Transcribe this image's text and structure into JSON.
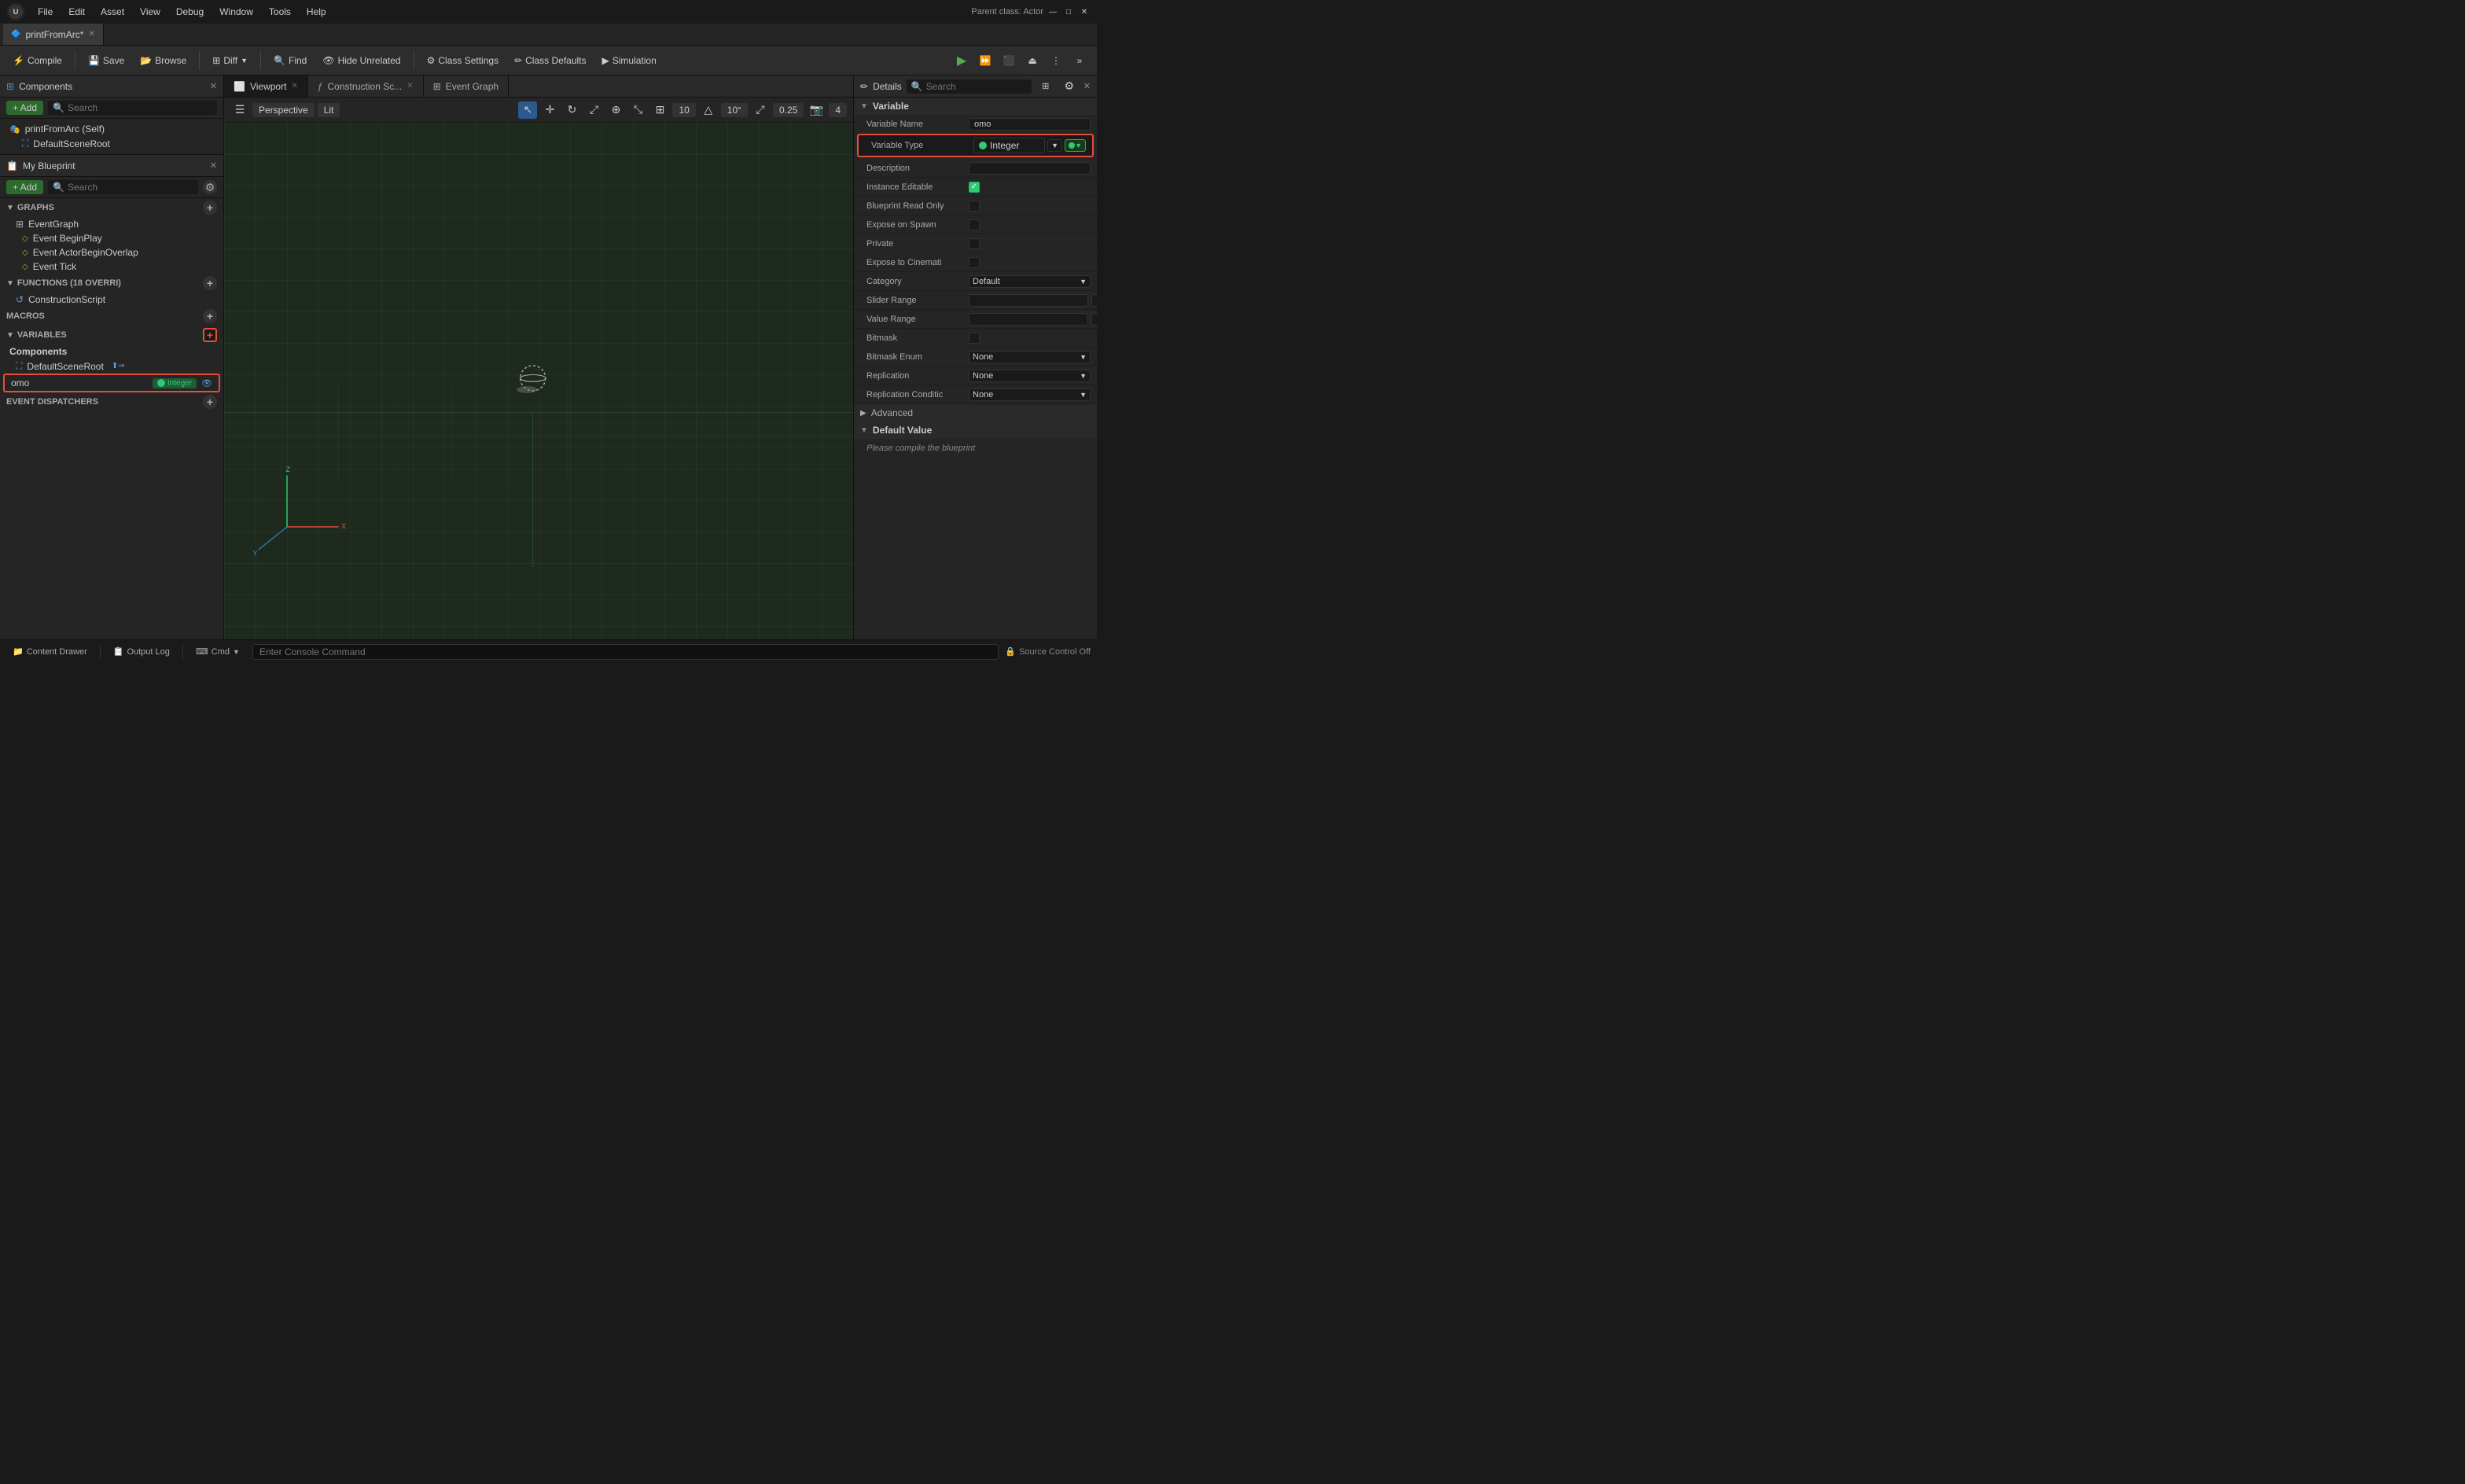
{
  "title": "printFromArc*",
  "parent_class": "Parent class: Actor",
  "menu": [
    "File",
    "Edit",
    "Asset",
    "View",
    "Debug",
    "Window",
    "Tools",
    "Help"
  ],
  "window_buttons": [
    "—",
    "□",
    "✕"
  ],
  "toolbar": {
    "compile": "Compile",
    "save": "Save",
    "browse": "Browse",
    "diff": "Diff",
    "find": "Find",
    "hide_unrelated": "Hide Unrelated",
    "class_settings": "Class Settings",
    "class_defaults": "Class Defaults",
    "simulation": "Simulation"
  },
  "components_panel": {
    "title": "Components",
    "add_label": "+ Add",
    "search_placeholder": "Search",
    "items": [
      {
        "label": "printFromArc (Self)",
        "type": "self"
      },
      {
        "label": "DefaultSceneRoot",
        "type": "root"
      }
    ]
  },
  "blueprint_panel": {
    "title": "My Blueprint",
    "add_label": "+ Add",
    "search_placeholder": "Search",
    "sections": {
      "graphs": "GRAPHS",
      "functions": "FUNCTIONS (18 OVERRI)",
      "macros": "MACROS",
      "variables": "VARIABLES",
      "event_dispatchers": "EVENT DISPATCHERS"
    },
    "graphs": [
      {
        "label": "EventGraph",
        "type": "graph"
      }
    ],
    "events": [
      {
        "label": "Event BeginPlay"
      },
      {
        "label": "Event ActorBeginOverlap"
      },
      {
        "label": "Event Tick"
      }
    ],
    "functions": [
      {
        "label": "ConstructionScript"
      }
    ],
    "variables": {
      "components_label": "Components",
      "component_items": [
        {
          "label": "DefaultSceneRoot",
          "type": "root"
        }
      ],
      "variables_list": [
        {
          "label": "omo",
          "type_label": "Integer",
          "type_color": "#2ecc71"
        }
      ]
    },
    "event_dispatchers_label": "EVENT DISPATCHERS"
  },
  "viewport": {
    "tabs": [
      "Viewport",
      "Construction Sc...",
      "Event Graph"
    ],
    "perspective_label": "Perspective",
    "lit_label": "Lit",
    "grid_number": "10",
    "angle_number": "10°",
    "scale_number": "0.25",
    "camera_number": "4"
  },
  "details": {
    "title": "Details",
    "search_placeholder": "Search",
    "sections": {
      "variable": "Variable",
      "advanced": "Advanced",
      "default_value": "Default Value"
    },
    "properties": {
      "variable_name_label": "Variable Name",
      "variable_name_value": "omo",
      "variable_type_label": "Variable Type",
      "variable_type_value": "Integer",
      "description_label": "Description",
      "instance_editable_label": "Instance Editable",
      "blueprint_read_only_label": "Blueprint Read Only",
      "expose_on_spawn_label": "Expose on Spawn",
      "private_label": "Private",
      "expose_to_cinemati_label": "Expose to Cinemati",
      "category_label": "Category",
      "category_value": "Default",
      "slider_range_label": "Slider Range",
      "value_range_label": "Value Range",
      "bitmask_label": "Bitmask",
      "bitmask_enum_label": "Bitmask Enum",
      "bitmask_enum_value": "None",
      "replication_label": "Replication",
      "replication_value": "None",
      "replication_conditi_label": "Replication Conditic",
      "replication_conditi_value": "None"
    },
    "default_value_text": "Please compile the blueprint"
  },
  "status_bar": {
    "content_drawer": "Content Drawer",
    "output_log": "Output Log",
    "cmd_label": "Cmd",
    "cmd_placeholder": "Enter Console Command",
    "source_control": "Source Control Off"
  }
}
